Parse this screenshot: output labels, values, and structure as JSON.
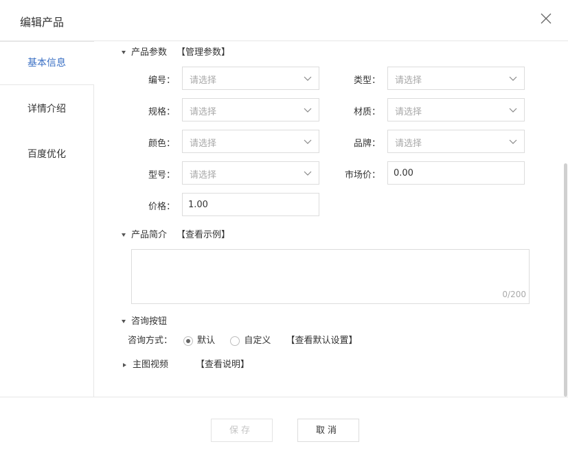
{
  "dialog": {
    "title": "编辑产品"
  },
  "sidebar": {
    "items": [
      {
        "label": "基本信息"
      },
      {
        "label": "详情介绍"
      },
      {
        "label": "百度优化"
      }
    ]
  },
  "params": {
    "heading": "产品参数",
    "manage_link": "【管理参数】",
    "fields": [
      {
        "label": "编号：",
        "placeholder": "请选择"
      },
      {
        "label": "类型：",
        "placeholder": "请选择"
      },
      {
        "label": "规格：",
        "placeholder": "请选择"
      },
      {
        "label": "材质：",
        "placeholder": "请选择"
      },
      {
        "label": "颜色：",
        "placeholder": "请选择"
      },
      {
        "label": "品牌：",
        "placeholder": "请选择"
      },
      {
        "label": "型号：",
        "placeholder": "请选择"
      },
      {
        "label": "市场价：",
        "value": "0.00"
      },
      {
        "label": "价格：",
        "value": "1.00"
      }
    ]
  },
  "intro": {
    "heading": "产品简介",
    "example_link": "【查看示例】",
    "counter": "0/200"
  },
  "consult": {
    "heading": "咨询按钮",
    "mode_label": "咨询方式：",
    "options": [
      "默认",
      "自定义"
    ],
    "selected": "默认",
    "settings_link": "【查看默认设置】"
  },
  "video": {
    "heading": "主图视频",
    "help_link": "【查看说明】"
  },
  "footer": {
    "save": "保存",
    "cancel": "取消"
  },
  "colors": {
    "accent": "#3a6fc4",
    "border": "#dcdcdc",
    "placeholder": "#a8a8a8"
  }
}
